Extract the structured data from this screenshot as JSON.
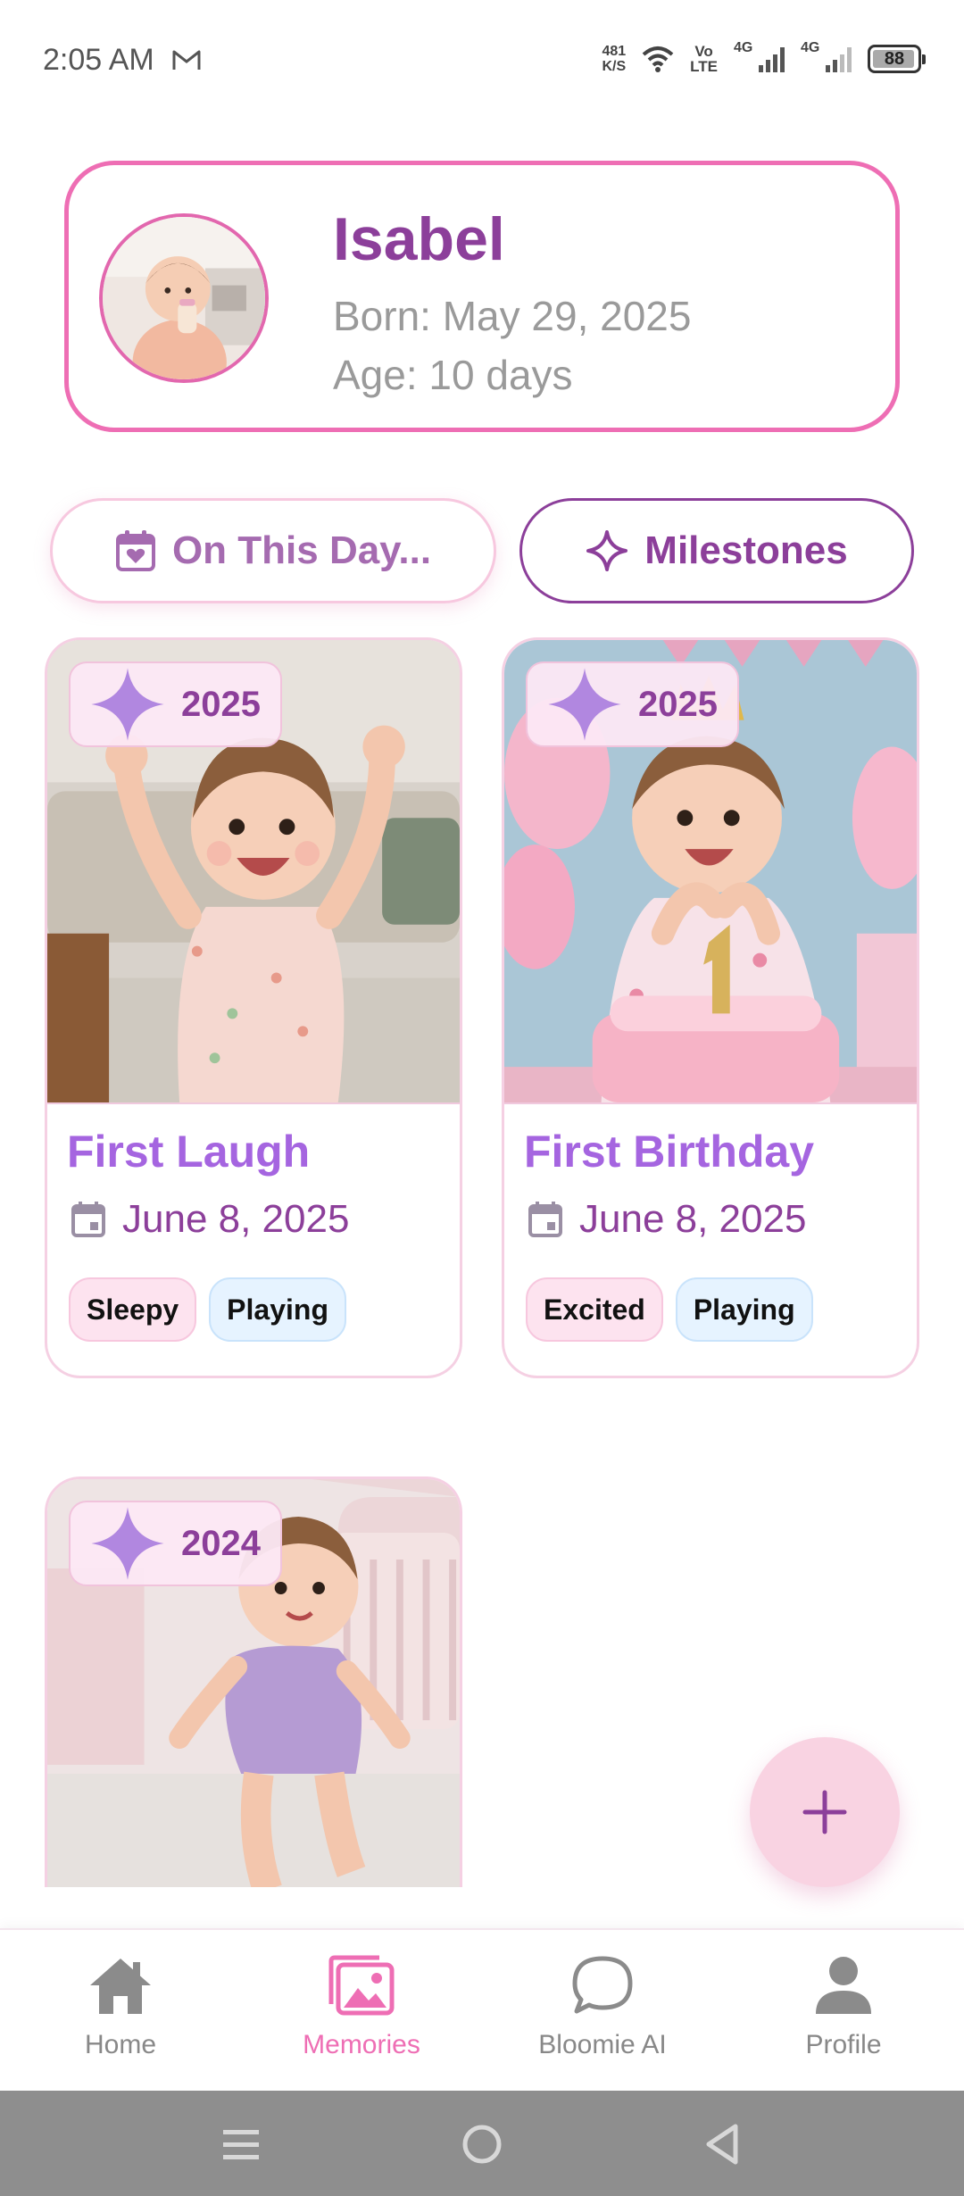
{
  "status_bar": {
    "time": "2:05 AM",
    "net_speed_value": "481",
    "net_speed_unit": "K/S",
    "volte_top": "Vo",
    "volte_bottom": "LTE",
    "sim1": "4G",
    "sim2": "4G",
    "battery": "88"
  },
  "profile": {
    "name": "Isabel",
    "born": "Born: May 29, 2025",
    "age": "Age: 10 days"
  },
  "actions": {
    "on_this_day": "On This Day...",
    "milestones": "Milestones"
  },
  "memories": [
    {
      "year": "2025",
      "title": "First Laugh",
      "date": "June 8, 2025",
      "tags": [
        "Sleepy",
        "Playing"
      ]
    },
    {
      "year": "2025",
      "title": "First Birthday",
      "date": "June 8, 2025",
      "tags": [
        "Excited",
        "Playing"
      ]
    },
    {
      "year": "2024"
    }
  ],
  "bottom_nav": {
    "items": [
      {
        "label": "Home",
        "icon": "home-icon"
      },
      {
        "label": "Memories",
        "icon": "gallery-icon"
      },
      {
        "label": "Bloomie AI",
        "icon": "chat-bubble-icon"
      },
      {
        "label": "Profile",
        "icon": "person-icon"
      }
    ],
    "active": "Memories"
  },
  "colors": {
    "accent_pink": "#ee6eb4",
    "accent_purple": "#8c3f9a",
    "title_lavender": "#a565e0"
  }
}
